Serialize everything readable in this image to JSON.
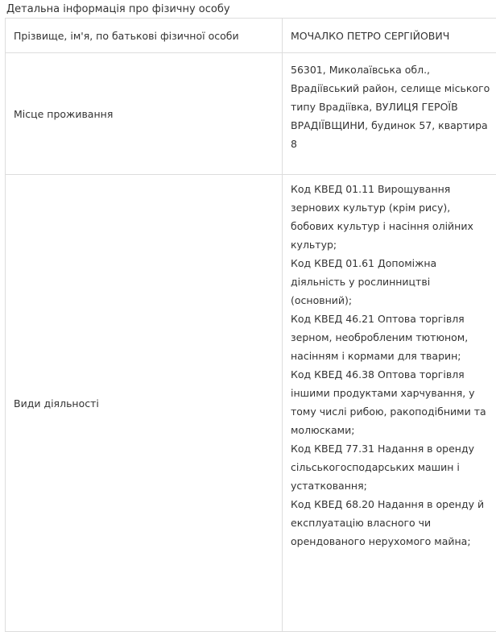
{
  "caption": "Детальна інформація про фізичну особу",
  "rows": {
    "name": {
      "label": "Прізвище, ім'я, по батькові фізичної особи",
      "value": "МОЧАЛКО ПЕТРО СЕРГІЙОВИЧ"
    },
    "address": {
      "label": "Місце проживання",
      "value": "56301, Миколаївська обл., Врадіївський район, селище міського типу Врадіївка, ВУЛИЦЯ ГЕРОЇВ ВРАДІЇВЩИНИ, будинок 57, квартира 8"
    },
    "activities": {
      "label": "Види діяльності",
      "items": [
        "Код КВЕД 01.11 Вирощування зернових культур (крім рису), бобових культур і насіння олійних культур;",
        "Код КВЕД 01.61 Допоміжна діяльність у рослинництві (основний);",
        "Код КВЕД 46.21 Оптова торгівля зерном, необробленим тютюном, насінням і кормами для тварин;",
        "Код КВЕД 46.38 Оптова торгівля іншими продуктами харчування, у тому числі рибою, ракоподібними та молюсками;",
        "Код КВЕД 77.31 Надання в оренду сільськогосподарських машин і устатковання;",
        "Код КВЕД 68.20 Надання в оренду й експлуатацію власного чи орендованого нерухомого майна;"
      ]
    }
  }
}
